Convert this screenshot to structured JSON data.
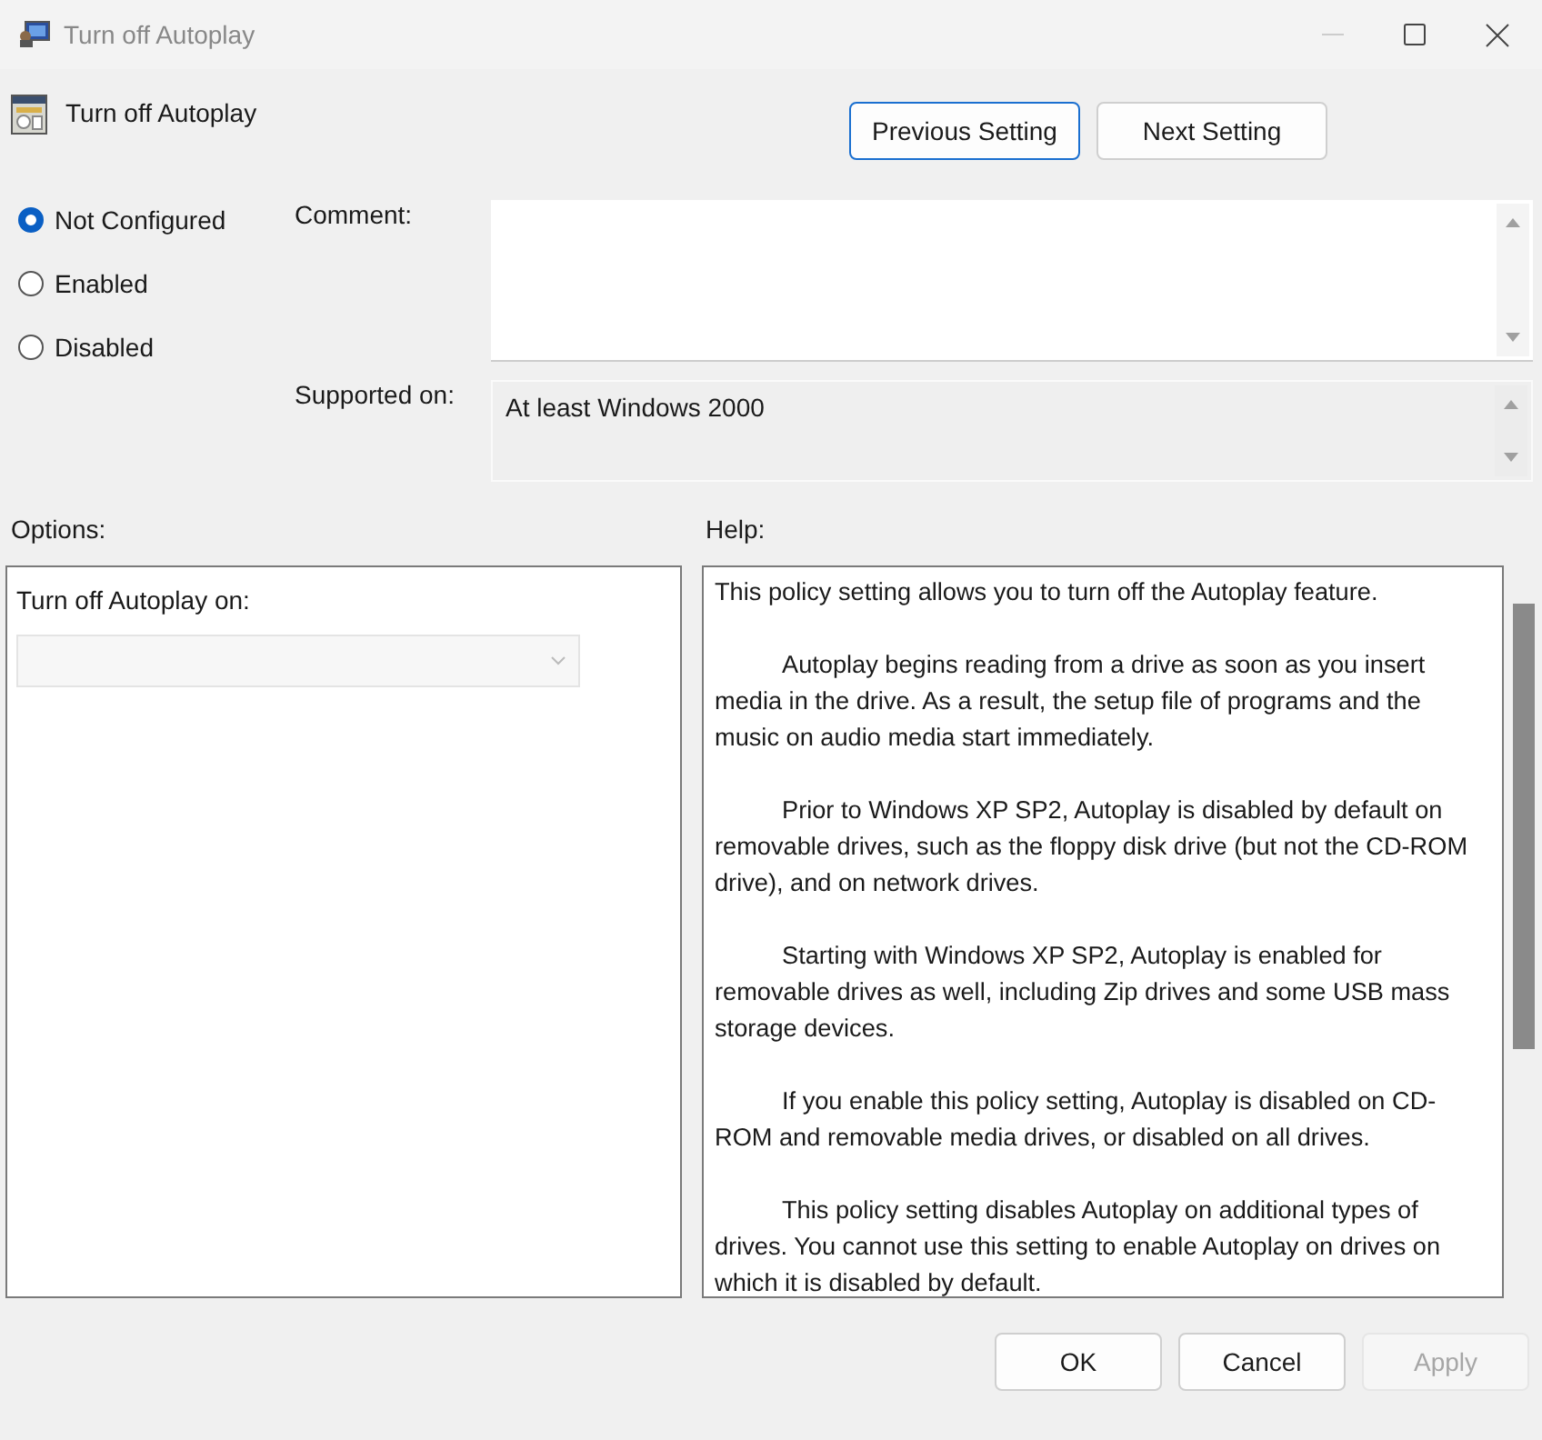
{
  "window": {
    "title": "Turn off Autoplay"
  },
  "policy_title": "Turn off Autoplay",
  "nav_buttons": [
    {
      "label": "Previous Setting",
      "focused": true
    },
    {
      "label": "Next Setting",
      "focused": false
    }
  ],
  "state_options": [
    {
      "label": "Not Configured",
      "selected": true
    },
    {
      "label": "Enabled",
      "selected": false
    },
    {
      "label": "Disabled",
      "selected": false
    }
  ],
  "comment": {
    "label": "Comment:"
  },
  "supported_on": {
    "label": "Supported on:",
    "value": "At least Windows 2000"
  },
  "options": {
    "label": "Options:",
    "field_label": "Turn off Autoplay on:",
    "dropdown_disabled": true
  },
  "help": {
    "label": "Help:",
    "paragraphs": [
      {
        "text": "This policy setting allows you to turn off the Autoplay feature.",
        "indented": false
      },
      {
        "text": "Autoplay begins reading from a drive as soon as you insert media in the drive. As a result, the setup file of programs and the music on audio media start immediately.",
        "indented": true
      },
      {
        "text": "Prior to Windows XP SP2, Autoplay is disabled by default on removable drives, such as the floppy disk drive (but not the CD-ROM drive), and on network drives.",
        "indented": true
      },
      {
        "text": "Starting with Windows XP SP2, Autoplay is enabled for removable drives as well, including Zip drives and some USB mass storage devices.",
        "indented": true
      },
      {
        "text": "If you enable this policy setting, Autoplay is disabled on CD-ROM and removable media drives, or disabled on all drives.",
        "indented": true
      },
      {
        "text": "This policy setting disables Autoplay on additional types of drives. You cannot use this setting to enable Autoplay on drives on which it is disabled by default.",
        "indented": true
      }
    ]
  },
  "buttons": [
    {
      "label": "OK",
      "disabled": false
    },
    {
      "label": "Cancel",
      "disabled": false
    },
    {
      "label": "Apply",
      "disabled": true
    }
  ]
}
